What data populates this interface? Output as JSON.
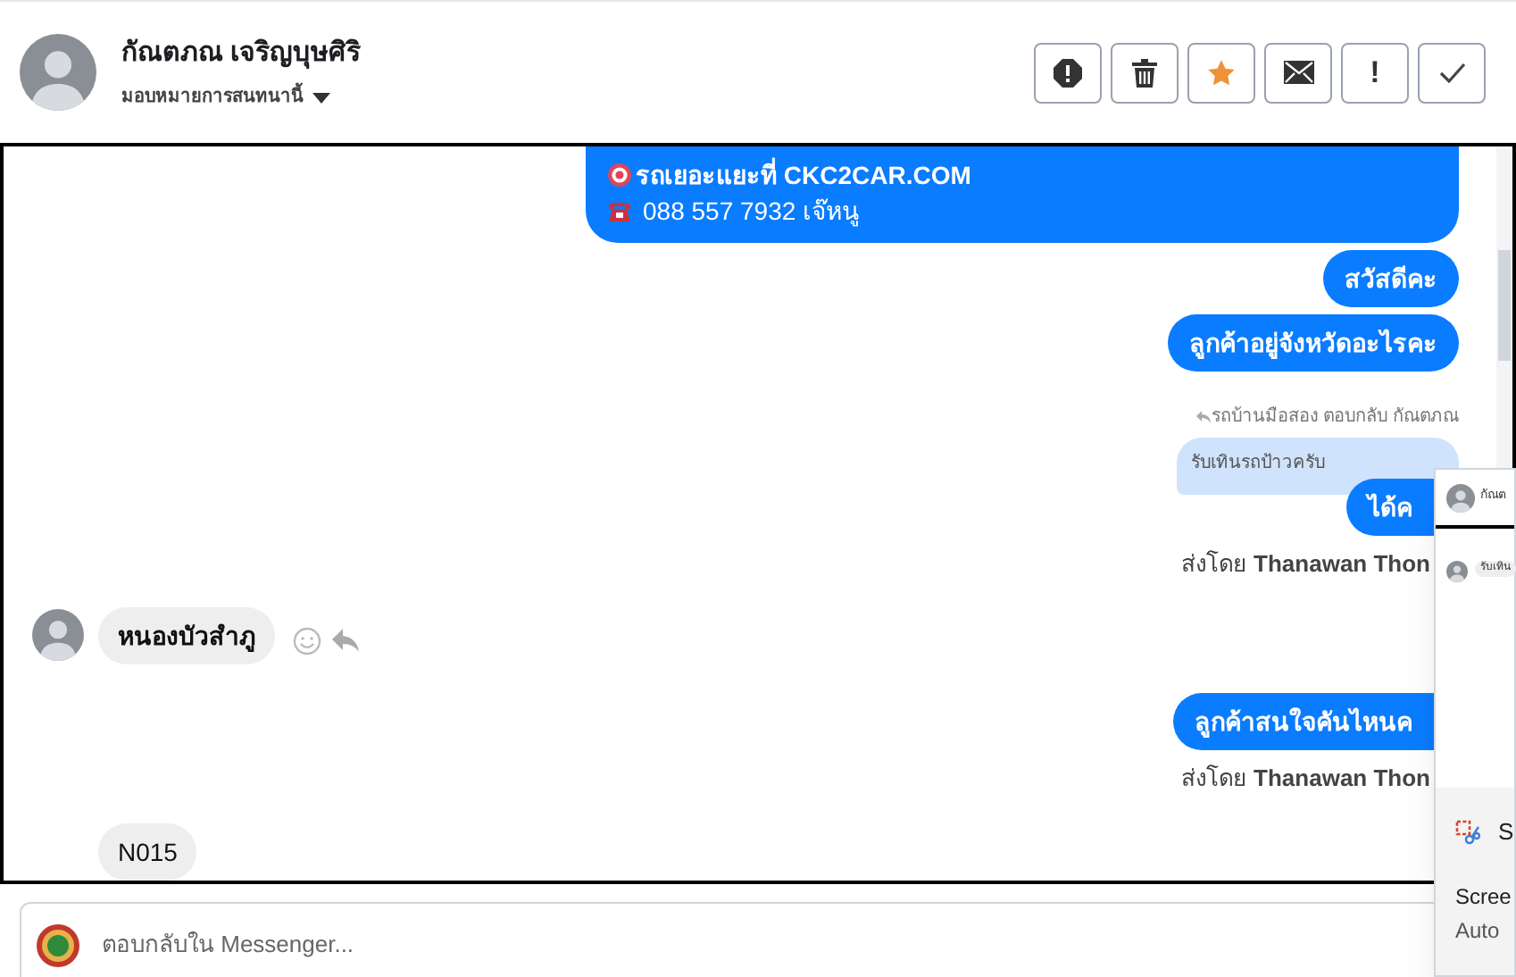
{
  "header": {
    "name": "กัณตภณ เจริญบุษศิริ",
    "assign_label": "มอบหมายการสนทนานี้",
    "actions": [
      {
        "kind": "alert"
      },
      {
        "kind": "trash"
      },
      {
        "kind": "star"
      },
      {
        "kind": "mail"
      },
      {
        "kind": "exclaim",
        "label": "!"
      },
      {
        "kind": "check"
      }
    ]
  },
  "messages": [
    {
      "kind": "outgoing",
      "lines": [
        "รถเยอะแยะที่ CKC2CAR.COM",
        "088 557 7932 เจ๊หนู"
      ]
    },
    {
      "kind": "outgoing",
      "text": "สวัสดีคะ"
    },
    {
      "kind": "outgoing",
      "text": "ลูกค้าอยู่จังหวัดอะไรคะ"
    },
    {
      "kind": "reply_header",
      "text": "รถบ้านมือสอง ตอบกลับ กัณตภณ"
    },
    {
      "kind": "quoted",
      "text": "รับเทินรถป้าวครับ"
    },
    {
      "kind": "outgoing_clipped",
      "text": "ได้ค"
    },
    {
      "kind": "sender",
      "text": "ส่งโดย **Thanawan Thon**"
    },
    {
      "kind": "incoming",
      "text": "หนองบัวสำภู"
    },
    {
      "kind": "outgoing_clipped",
      "text": "ลูกค้าสนใจคันไหนค"
    },
    {
      "kind": "sender",
      "text": "ส่งโดย **Thanawan Thon**"
    },
    {
      "kind": "incoming_plain",
      "text": "N015"
    }
  ],
  "composer": {
    "placeholder": "ตอบกลับใน Messenger..."
  },
  "snip_overlay": {
    "preview_name": "กัณต",
    "preview_message": "รับเทิน",
    "app_initial": "S",
    "lines": [
      "Scree",
      "Auto"
    ]
  }
}
